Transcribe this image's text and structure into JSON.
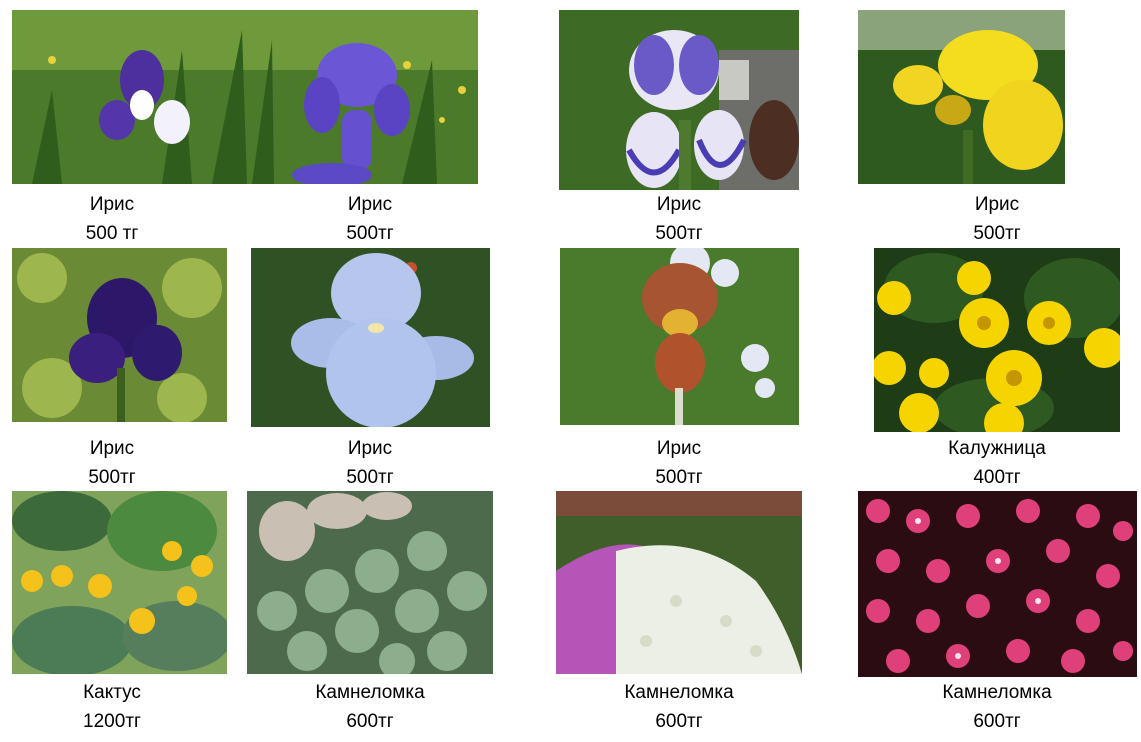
{
  "items": [
    {
      "name": "Ирис",
      "price": "500 тг"
    },
    {
      "name": "Ирис",
      "price": "500тг"
    },
    {
      "name": "Ирис",
      "price": "500тг"
    },
    {
      "name": "Ирис",
      "price": "500тг"
    },
    {
      "name": "Ирис",
      "price": "500тг"
    },
    {
      "name": "Ирис",
      "price": "500тг"
    },
    {
      "name": "Ирис",
      "price": "500тг"
    },
    {
      "name": "Калужница",
      "price": "400тг"
    },
    {
      "name": "Кактус",
      "price": "1200тг"
    },
    {
      "name": "Камнеломка",
      "price": "600тг"
    },
    {
      "name": "Камнеломка",
      "price": "600тг"
    },
    {
      "name": "Камнеломка",
      "price": "600тг"
    }
  ]
}
